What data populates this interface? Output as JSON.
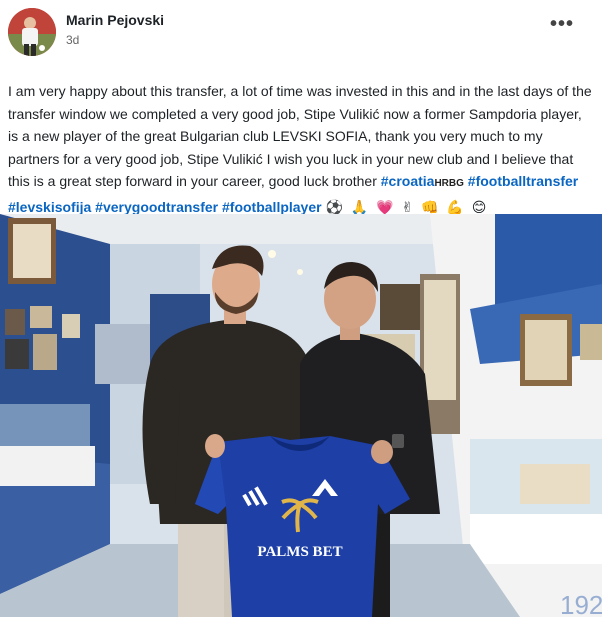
{
  "post": {
    "author": "Marin Pejovski",
    "time": "3d",
    "more_label": "•••",
    "text_main": "I am very happy about this transfer, a lot of time was invested in this and in the last days of the transfer window we completed a very good job, Stipe Vulikić now a former Sampdoria player, is a new player of the great Bulgarian club LEVSKI SOFIA, thank you very much to my partners for a very good job, Stipe Vulikić I wish you luck in your new club and I believe that this is a great step forward in your career, good luck brother ",
    "hashtags": {
      "croatia": "#croatia",
      "hrbg": "HRBG",
      "footballtransfer": "#footballtransfer",
      "levskisofija": "#levskisofija",
      "verygoodtransfer": "#verygoodtransfer",
      "footballplayer": "#footballplayer"
    },
    "emojis": "⚽ 🙏 💗 ✌ 👊 💪 😊"
  },
  "photo": {
    "jersey_sponsor": "PALMS BET"
  },
  "colors": {
    "link": "#0a66c2",
    "jersey": "#1d3fa6",
    "wall": "#dde6ee"
  }
}
